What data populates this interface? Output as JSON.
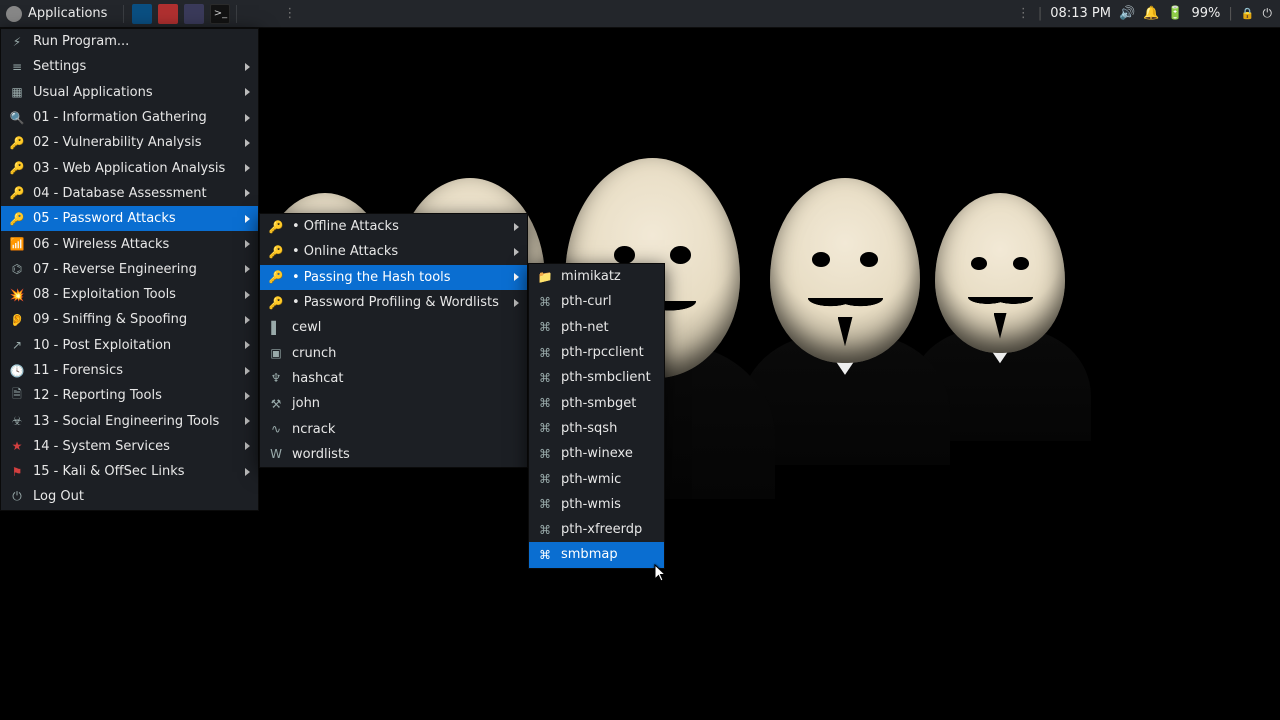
{
  "panel": {
    "applications_label": "Applications",
    "clock": "08:13 PM",
    "battery": "99%"
  },
  "main_menu": {
    "items": [
      {
        "label": "Run Program...",
        "icon": "⚡",
        "arrow": false
      },
      {
        "label": "Settings",
        "icon": "≡",
        "arrow": true
      },
      {
        "label": "Usual Applications",
        "icon": "▦",
        "arrow": true
      },
      {
        "label": "01 - Information Gathering",
        "icon": "🔍",
        "arrow": true
      },
      {
        "label": "02 - Vulnerability Analysis",
        "icon": "🔑",
        "arrow": true
      },
      {
        "label": "03 - Web Application Analysis",
        "icon": "🔑",
        "arrow": true
      },
      {
        "label": "04 - Database Assessment",
        "icon": "🔑",
        "arrow": true
      },
      {
        "label": "05 - Password Attacks",
        "icon": "🔑",
        "arrow": true,
        "hl": true
      },
      {
        "label": "06 - Wireless Attacks",
        "icon": "📶",
        "arrow": true
      },
      {
        "label": "07 - Reverse Engineering",
        "icon": "⌬",
        "arrow": true
      },
      {
        "label": "08 - Exploitation Tools",
        "icon": "💥",
        "arrow": true
      },
      {
        "label": "09 - Sniffing & Spoofing",
        "icon": "👂",
        "arrow": true
      },
      {
        "label": "10 - Post Exploitation",
        "icon": "↗",
        "arrow": true
      },
      {
        "label": "11 - Forensics",
        "icon": "🕓",
        "arrow": true
      },
      {
        "label": "12 - Reporting Tools",
        "icon": "🗎",
        "arrow": true
      },
      {
        "label": "13 - Social Engineering Tools",
        "icon": "☣",
        "arrow": true
      },
      {
        "label": "14 - System Services",
        "icon": "★",
        "arrow": true,
        "iconClass": "red"
      },
      {
        "label": "15 - Kali & OffSec Links",
        "icon": "⚑",
        "arrow": true,
        "iconClass": "red"
      },
      {
        "label": "Log Out",
        "icon": "⏻",
        "arrow": false
      }
    ]
  },
  "sub1": {
    "items": [
      {
        "label": "• Offline Attacks",
        "icon": "🔑",
        "arrow": true
      },
      {
        "label": "• Online Attacks",
        "icon": "🔑",
        "arrow": true
      },
      {
        "label": "• Passing the Hash tools",
        "icon": "🔑",
        "arrow": true,
        "hl": true
      },
      {
        "label": "• Password Profiling & Wordlists",
        "icon": "🔑",
        "arrow": true
      },
      {
        "label": "cewl",
        "icon": "▌",
        "arrow": false
      },
      {
        "label": "crunch",
        "icon": "▣",
        "arrow": false
      },
      {
        "label": "hashcat",
        "icon": "♆",
        "arrow": false
      },
      {
        "label": "john",
        "icon": "⚒",
        "arrow": false
      },
      {
        "label": "ncrack",
        "icon": "∿",
        "arrow": false
      },
      {
        "label": "wordlists",
        "icon": "W",
        "arrow": false
      }
    ]
  },
  "sub2": {
    "items": [
      {
        "label": "mimikatz",
        "icon": "📁"
      },
      {
        "label": "pth-curl",
        "icon": "⌘"
      },
      {
        "label": "pth-net",
        "icon": "⌘"
      },
      {
        "label": "pth-rpcclient",
        "icon": "⌘"
      },
      {
        "label": "pth-smbclient",
        "icon": "⌘"
      },
      {
        "label": "pth-smbget",
        "icon": "⌘"
      },
      {
        "label": "pth-sqsh",
        "icon": "⌘"
      },
      {
        "label": "pth-winexe",
        "icon": "⌘"
      },
      {
        "label": "pth-wmic",
        "icon": "⌘"
      },
      {
        "label": "pth-wmis",
        "icon": "⌘"
      },
      {
        "label": "pth-xfreerdp",
        "icon": "⌘"
      },
      {
        "label": "smbmap",
        "icon": "⌘",
        "hl": true
      }
    ]
  }
}
